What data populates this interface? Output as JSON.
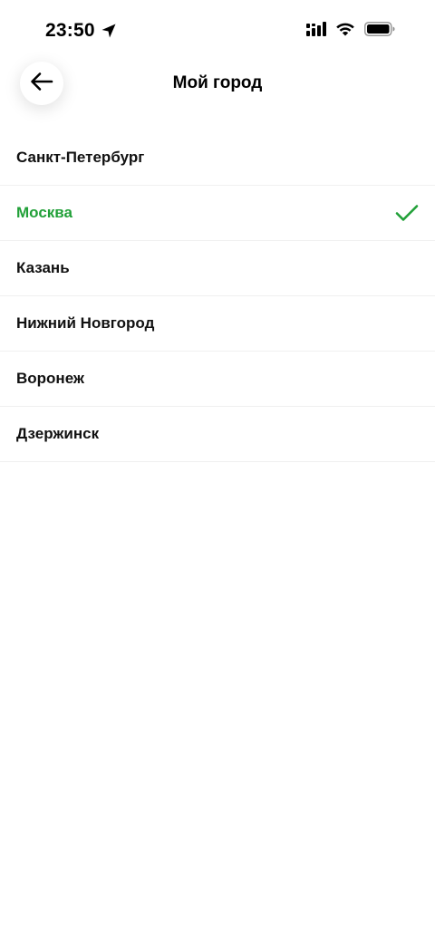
{
  "status_bar": {
    "time": "23:50",
    "icons": [
      "location-arrow-icon",
      "cellular-signal-icon",
      "wifi-icon",
      "battery-icon"
    ]
  },
  "header": {
    "title": "Мой город",
    "back_icon": "arrow-left-icon"
  },
  "cities": [
    {
      "label": "Санкт-Петербург",
      "selected": false
    },
    {
      "label": "Москва",
      "selected": true
    },
    {
      "label": "Казань",
      "selected": false
    },
    {
      "label": "Нижний Новгород",
      "selected": false
    },
    {
      "label": "Воронеж",
      "selected": false
    },
    {
      "label": "Дзержинск",
      "selected": false
    }
  ],
  "colors": {
    "accent": "#21a038",
    "text": "#111111",
    "divider": "#f0f0f0",
    "background": "#ffffff"
  }
}
